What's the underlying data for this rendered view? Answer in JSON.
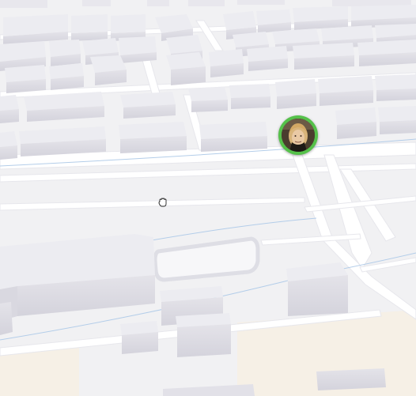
{
  "map": {
    "style": "3d-light",
    "background_color": "#f1f1f3",
    "road_color": "#ffffff",
    "building_top_color": "#ecebef",
    "building_side_color": "#dcdbe2",
    "waterway_color": "#a9c6e6",
    "sand_area_color": "#f5efe5"
  },
  "user_marker": {
    "icon": "user-avatar-pin",
    "ring_color": "#55c14a"
  },
  "cursor": {
    "icon": "hand-grab-cursor"
  }
}
